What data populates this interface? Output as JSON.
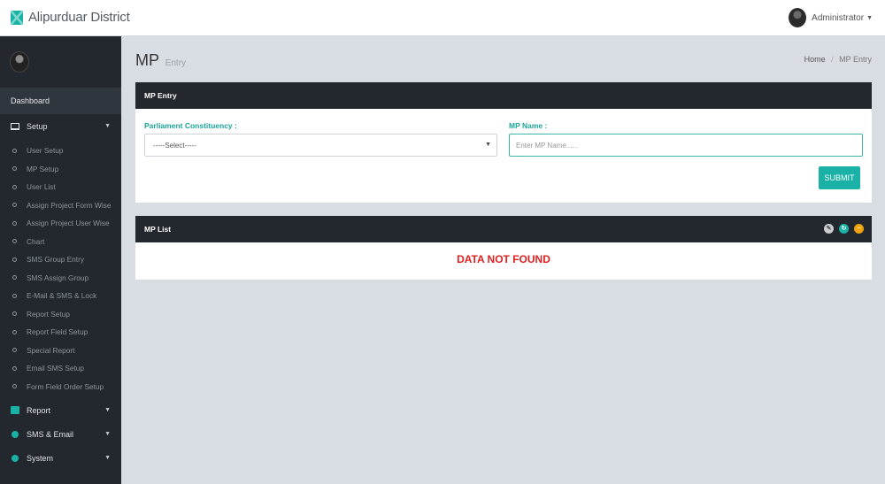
{
  "app": {
    "title": "Alipurduar District"
  },
  "user": {
    "name": "Administrator"
  },
  "sidebar": {
    "dashboard": "Dashboard",
    "setup": {
      "label": "Setup",
      "items": [
        "User Setup",
        "MP Setup",
        "User List",
        "Assign Project Form Wise",
        "Assign Project User Wise",
        "Chart",
        "SMS Group Entry",
        "SMS Assign Group",
        "E-Mail & SMS & Lock",
        "Report Setup",
        "Report Field Setup",
        "Special Report",
        "Email SMS Setup",
        "Form Field Order Setup"
      ]
    },
    "report": "Report",
    "sms_email": "SMS & Email",
    "system": "System"
  },
  "page": {
    "title": "MP",
    "subtitle": "Entry"
  },
  "breadcrumb": {
    "home": "Home",
    "current": "MP Entry"
  },
  "entry_panel": {
    "title": "MP Entry",
    "constituency_label": "Parliament Constituency :",
    "constituency_selected": "-----Select-----",
    "mp_name_label": "MP Name :",
    "mp_name_placeholder": "Enter MP Name......",
    "mp_name_value": "",
    "submit": "SUBMIT"
  },
  "list_panel": {
    "title": "MP List",
    "empty_message": "DATA NOT FOUND"
  },
  "colors": {
    "accent": "#1ab2a6",
    "sidebar": "#23282e",
    "error": "#e02020",
    "warning": "#f0a30a"
  }
}
